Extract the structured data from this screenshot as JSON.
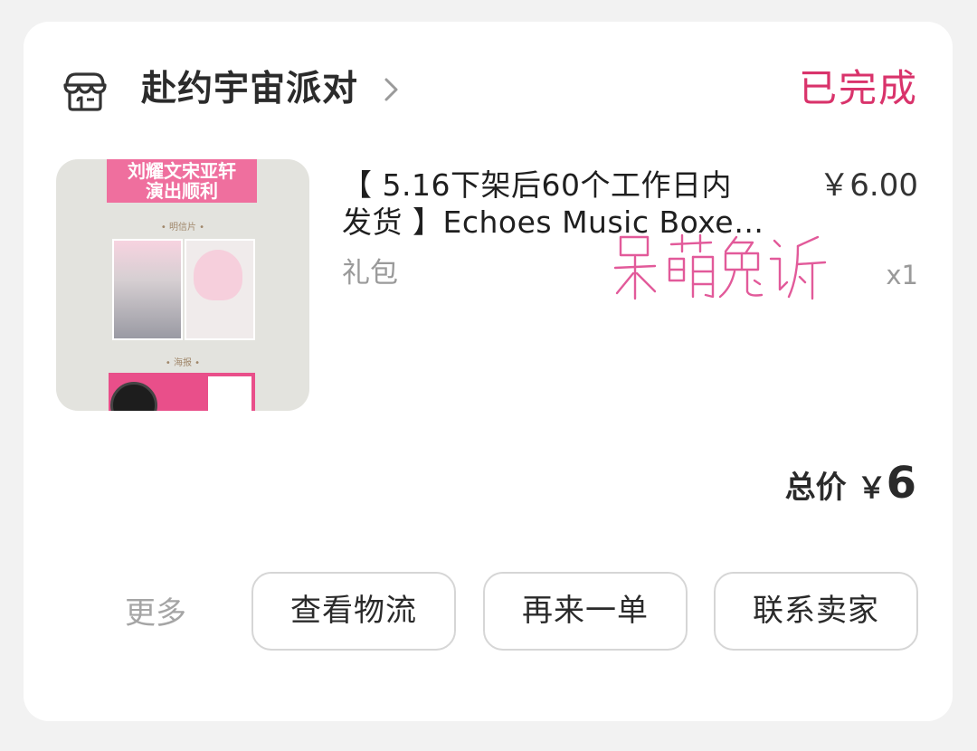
{
  "shop": {
    "name": "赴约宇宙派对",
    "icon": "shop-icon",
    "chevron_icon": "chevron-right-icon"
  },
  "order": {
    "status": "已完成",
    "status_color": "#d9336b"
  },
  "product": {
    "title_line1": "【 5.16下架后60个工作日内",
    "title_line2": "发货 】Echoes Music Boxe…",
    "variant": "礼包",
    "unit_price": "￥6.00",
    "quantity": "x1",
    "thumbnail": {
      "banner_line1": "刘耀文宋亚轩",
      "banner_line2": "演出顺利",
      "section1": "• 明信片 •",
      "section2": "• 海报 •"
    }
  },
  "watermark": "呆萌兔诉",
  "total": {
    "label": "总价",
    "currency": "￥",
    "amount": "6"
  },
  "actions": {
    "more": "更多",
    "view_logistics": "查看物流",
    "reorder": "再来一单",
    "contact_seller": "联系卖家"
  }
}
